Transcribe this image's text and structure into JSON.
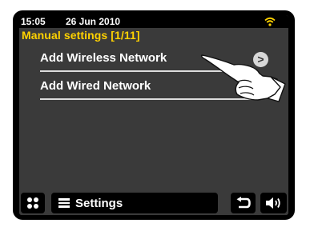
{
  "status": {
    "time": "15:05",
    "date": "26 Jun 2010",
    "wifi_icon": "wifi-icon",
    "accent_color": "#ffd200"
  },
  "header": {
    "title": "Manual settings [1/11]"
  },
  "menu": {
    "items": [
      {
        "label": "Add Wireless Network",
        "chevron": ">"
      },
      {
        "label": "Add Wired Network",
        "chevron": ">"
      }
    ]
  },
  "overlay": {
    "icon": "pointing-hand-icon"
  },
  "bottom_bar": {
    "home_icon": "home-grid-icon",
    "menu_icon": "menu-lines-icon",
    "settings_label": "Settings",
    "back_icon": "back-arrow-icon",
    "volume_icon": "speaker-volume-icon"
  }
}
